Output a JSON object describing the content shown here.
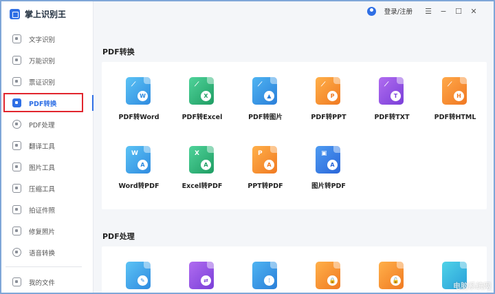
{
  "app": {
    "title": "掌上识别王"
  },
  "topbar": {
    "login": "登录/注册",
    "menu_icon": "☰",
    "minimize_icon": "−",
    "maximize_icon": "☐",
    "close_icon": "✕"
  },
  "sidebar": {
    "items": [
      {
        "label": "文字识别",
        "icon": "text-recognition-icon"
      },
      {
        "label": "万能识别",
        "icon": "universal-recognition-icon"
      },
      {
        "label": "票证识别",
        "icon": "ticket-recognition-icon"
      },
      {
        "label": "PDF转换",
        "icon": "pdf-convert-icon"
      },
      {
        "label": "PDF处理",
        "icon": "pdf-process-icon"
      },
      {
        "label": "翻译工具",
        "icon": "translate-icon"
      },
      {
        "label": "图片工具",
        "icon": "image-tools-icon"
      },
      {
        "label": "压缩工具",
        "icon": "compress-icon"
      },
      {
        "label": "拍证件照",
        "icon": "id-photo-icon"
      },
      {
        "label": "修复照片",
        "icon": "repair-photo-icon"
      },
      {
        "label": "语音转换",
        "icon": "voice-convert-icon"
      }
    ],
    "active_index": 3,
    "my_files": "我的文件"
  },
  "sections": {
    "pdf_convert": {
      "title": "PDF转换",
      "tools": [
        {
          "label": "PDF转Word",
          "badge": "W"
        },
        {
          "label": "PDF转Excel",
          "badge": "X"
        },
        {
          "label": "PDF转图片",
          "badge": "▲"
        },
        {
          "label": "PDF转PPT",
          "badge": "P"
        },
        {
          "label": "PDF转TXT",
          "badge": "T"
        },
        {
          "label": "PDF转HTML",
          "badge": "H"
        },
        {
          "label": "Word转PDF",
          "badge": "A"
        },
        {
          "label": "Excel转PDF",
          "badge": "A"
        },
        {
          "label": "PPT转PDF",
          "badge": "A"
        },
        {
          "label": "图片转PDF",
          "badge": "A"
        }
      ]
    },
    "pdf_process": {
      "title": "PDF处理"
    }
  },
  "colors": {
    "accent": "#2f6fe5",
    "blue": "#2f9be8",
    "green": "#2cb27a",
    "orange": "#f28a2c",
    "purple": "#8a4fe0",
    "highlight_box": "#e1252d"
  },
  "watermark": "电脑系统网"
}
